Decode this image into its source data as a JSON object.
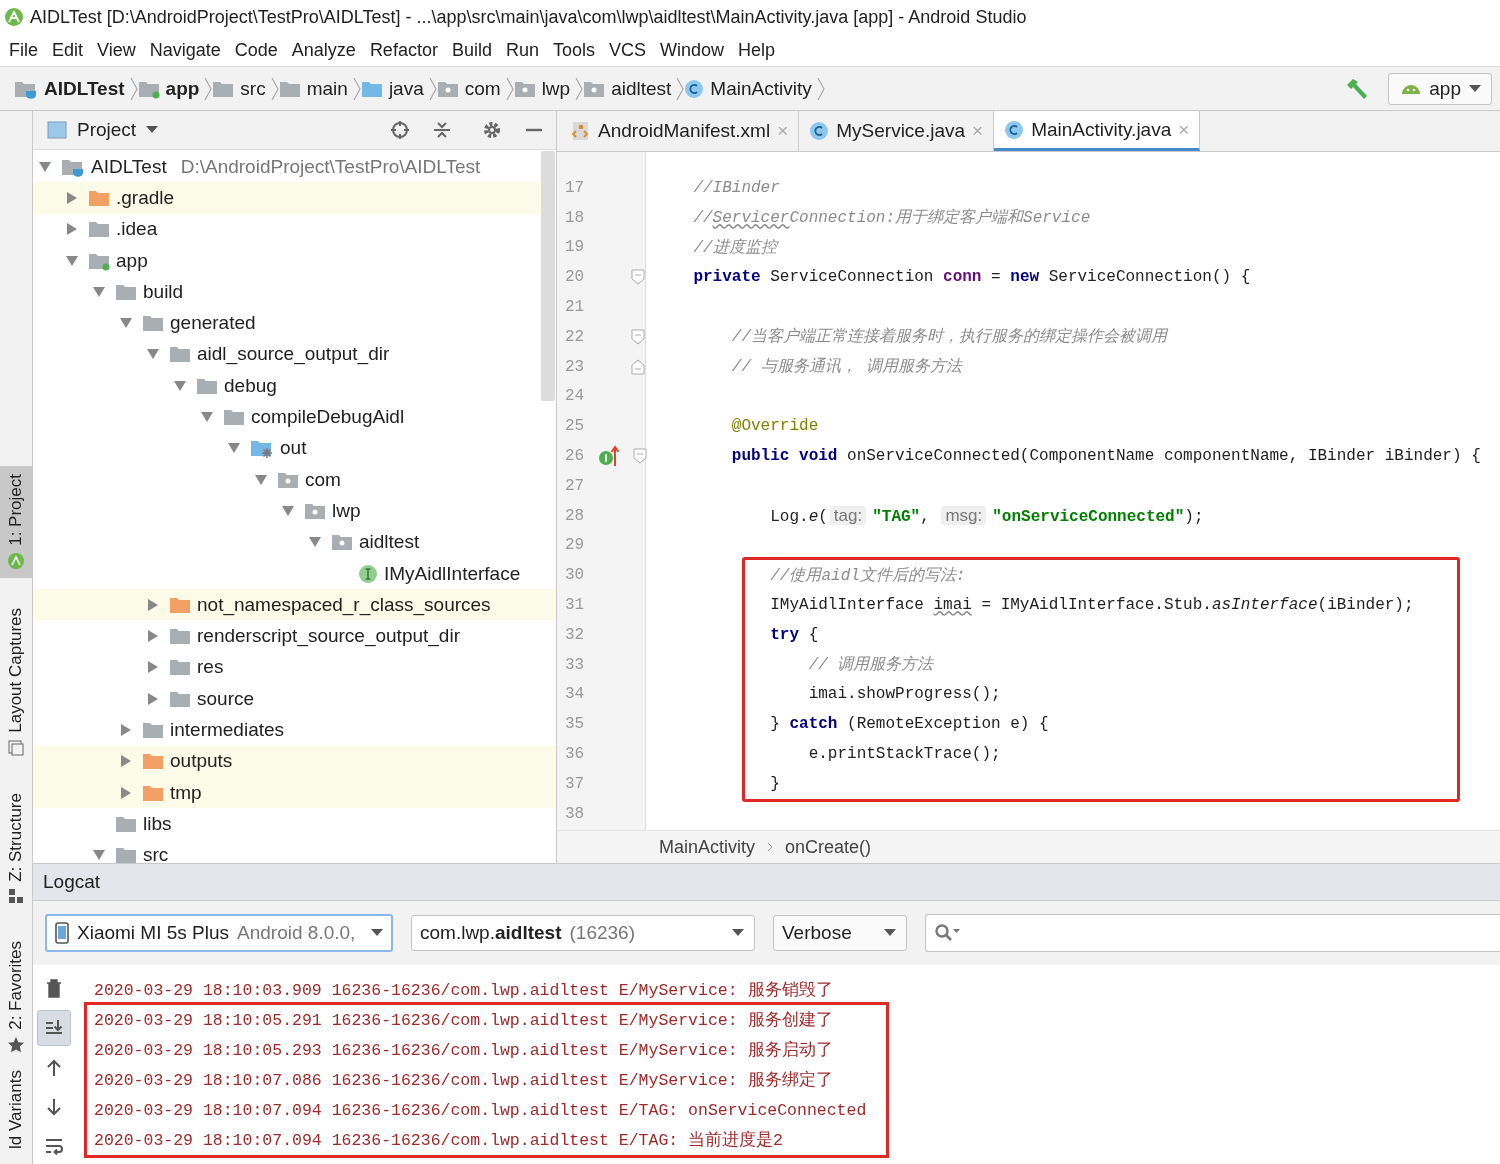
{
  "window": {
    "title": "AIDLTest [D:\\AndroidProject\\TestPro\\AIDLTest] - ...\\app\\src\\main\\java\\com\\lwp\\aidltest\\MainActivity.java [app] - Android Studio"
  },
  "menu": [
    "File",
    "Edit",
    "View",
    "Navigate",
    "Code",
    "Analyze",
    "Refactor",
    "Build",
    "Run",
    "Tools",
    "VCS",
    "Window",
    "Help"
  ],
  "navigation_bar": {
    "crumbs": [
      {
        "label": "AIDLTest",
        "kind": "project"
      },
      {
        "label": "app",
        "kind": "module"
      },
      {
        "label": "src",
        "kind": "folder"
      },
      {
        "label": "main",
        "kind": "folder"
      },
      {
        "label": "java",
        "kind": "source"
      },
      {
        "label": "com",
        "kind": "package"
      },
      {
        "label": "lwp",
        "kind": "package"
      },
      {
        "label": "aidltest",
        "kind": "package"
      },
      {
        "label": "MainActivity",
        "kind": "class"
      }
    ],
    "run_config": "app"
  },
  "tool_strip": [
    {
      "label": "1: Project",
      "kind": "android",
      "selected": true
    },
    {
      "label": "Layout Captures",
      "kind": "capture",
      "selected": false
    },
    {
      "label": "Z: Structure",
      "kind": "structure",
      "selected": false
    },
    {
      "label": "2: Favorites",
      "kind": "star",
      "selected": false
    },
    {
      "label": "ld Variants",
      "kind": "none",
      "selected": false
    }
  ],
  "project_panel": {
    "title": "Project",
    "tree": [
      {
        "label": "AIDLTest",
        "path": "D:\\AndroidProject\\TestPro\\AIDLTest",
        "kind": "project",
        "expanded": true,
        "children": [
          {
            "label": ".gradle",
            "kind": "excluded",
            "expanded": false
          },
          {
            "label": ".idea",
            "kind": "folder",
            "expanded": false
          },
          {
            "label": "app",
            "kind": "module",
            "expanded": true,
            "children": [
              {
                "label": "build",
                "kind": "folder",
                "expanded": true,
                "children": [
                  {
                    "label": "generated",
                    "kind": "folder",
                    "expanded": true,
                    "children": [
                      {
                        "label": "aidl_source_output_dir",
                        "kind": "folder",
                        "expanded": true,
                        "children": [
                          {
                            "label": "debug",
                            "kind": "folder",
                            "expanded": true,
                            "children": [
                              {
                                "label": "compileDebugAidl",
                                "kind": "folder",
                                "expanded": true,
                                "children": [
                                  {
                                    "label": "out",
                                    "kind": "generated",
                                    "expanded": true,
                                    "children": [
                                      {
                                        "label": "com",
                                        "kind": "package",
                                        "expanded": true,
                                        "children": [
                                          {
                                            "label": "lwp",
                                            "kind": "package",
                                            "expanded": true,
                                            "children": [
                                              {
                                                "label": "aidltest",
                                                "kind": "package",
                                                "expanded": true,
                                                "children": [
                                                  {
                                                    "label": "IMyAidlInterface",
                                                    "kind": "interface"
                                                  }
                                                ]
                                              }
                                            ]
                                          }
                                        ]
                                      }
                                    ]
                                  }
                                ]
                              }
                            ]
                          }
                        ]
                      },
                      {
                        "label": "not_namespaced_r_class_sources",
                        "kind": "excluded",
                        "expanded": false
                      },
                      {
                        "label": "renderscript_source_output_dir",
                        "kind": "folder",
                        "expanded": false
                      },
                      {
                        "label": "res",
                        "kind": "folder",
                        "expanded": false
                      },
                      {
                        "label": "source",
                        "kind": "folder",
                        "expanded": false
                      }
                    ]
                  },
                  {
                    "label": "intermediates",
                    "kind": "folder",
                    "expanded": false
                  },
                  {
                    "label": "outputs",
                    "kind": "excluded",
                    "expanded": false
                  },
                  {
                    "label": "tmp",
                    "kind": "excluded",
                    "expanded": false
                  }
                ]
              },
              {
                "label": "libs",
                "kind": "folder"
              },
              {
                "label": "src",
                "kind": "folder",
                "expanded": true
              }
            ]
          }
        ]
      }
    ]
  },
  "editor": {
    "tabs": [
      {
        "label": "AndroidManifest.xml",
        "kind": "xml",
        "selected": false,
        "close": "×"
      },
      {
        "label": "MyService.java",
        "kind": "class",
        "selected": false,
        "close": "×"
      },
      {
        "label": "MainActivity.java",
        "kind": "class",
        "selected": true,
        "close": "×"
      }
    ],
    "lines": [
      {
        "number": "17",
        "marked": false,
        "tokens": [
          {
            "kind": "comment",
            "text": "    //IBinder"
          }
        ]
      },
      {
        "number": "18",
        "marked": false,
        "tokens": [
          {
            "kind": "comment",
            "text": "    //"
          },
          {
            "kind": "comment-warn",
            "text": "Servicer"
          },
          {
            "kind": "comment",
            "text": "Connection:用于绑定客户端和Service"
          }
        ]
      },
      {
        "number": "19",
        "marked": false,
        "tokens": [
          {
            "kind": "comment",
            "text": "    //进度监控"
          }
        ]
      },
      {
        "number": "20",
        "marked": false,
        "gutter_icons": [
          {
            "kind": "fold-start"
          }
        ],
        "tokens": [
          {
            "kind": "keyword",
            "text": "    private"
          },
          {
            "kind": "plain",
            "text": " ServiceConnection "
          },
          {
            "kind": "field",
            "text": "conn"
          },
          {
            "kind": "plain",
            "text": " = "
          },
          {
            "kind": "keyword",
            "text": "new"
          },
          {
            "kind": "plain",
            "text": " ServiceConnection() {"
          }
        ]
      },
      {
        "number": "21",
        "marked": false
      },
      {
        "number": "22",
        "marked": false,
        "gutter_icons": [
          {
            "kind": "fold-start"
          }
        ],
        "tokens": [
          {
            "kind": "comment",
            "text": "        //当客户端正常连接着服务时，执行服务的绑定操作会被调用"
          }
        ]
      },
      {
        "number": "23",
        "marked": false,
        "gutter_icons": [
          {
            "kind": "fold-end"
          }
        ],
        "tokens": [
          {
            "kind": "comment",
            "text": "        // 与服务通讯， 调用服务方法"
          }
        ]
      },
      {
        "number": "24",
        "marked": false
      },
      {
        "number": "25",
        "marked": false,
        "tokens": [
          {
            "kind": "annotation",
            "text": "        @Override"
          }
        ]
      },
      {
        "number": "26",
        "marked": false,
        "gutter_icons": [
          {
            "kind": "implements"
          },
          {
            "kind": "fold-start"
          }
        ],
        "tokens": [
          {
            "kind": "keyword",
            "text": "        public void"
          },
          {
            "kind": "plain",
            "text": " onServiceConnected(ComponentName componentName, IBinder iBinder) {"
          }
        ]
      },
      {
        "number": "27",
        "marked": false
      },
      {
        "number": "28",
        "marked": false,
        "tokens": [
          {
            "kind": "plain",
            "text": "            Log."
          },
          {
            "kind": "italic",
            "text": "e"
          },
          {
            "kind": "plain",
            "text": "("
          },
          {
            "kind": "hint",
            "text": "tag:"
          },
          {
            "kind": "string",
            "text": "\"TAG\""
          },
          {
            "kind": "plain",
            "text": ", "
          },
          {
            "kind": "hint",
            "text": "msg:"
          },
          {
            "kind": "string",
            "text": "\"onServiceConnected\""
          },
          {
            "kind": "plain",
            "text": ");"
          }
        ]
      },
      {
        "number": "29",
        "marked": false
      },
      {
        "number": "30",
        "marked": true,
        "tokens": [
          {
            "kind": "comment",
            "text": "            //使用aidl文件后的写法:"
          }
        ]
      },
      {
        "number": "31",
        "marked": true,
        "tokens": [
          {
            "kind": "plain",
            "text": "            IMyAidlInterface "
          },
          {
            "kind": "warn",
            "text": "imai"
          },
          {
            "kind": "plain",
            "text": " = IMyAidlInterface.Stub."
          },
          {
            "kind": "italic",
            "text": "asInterface"
          },
          {
            "kind": "plain",
            "text": "(iBinder);"
          }
        ]
      },
      {
        "number": "32",
        "marked": true,
        "tokens": [
          {
            "kind": "keyword",
            "text": "            try"
          },
          {
            "kind": "plain",
            "text": " {"
          }
        ]
      },
      {
        "number": "33",
        "marked": true,
        "tokens": [
          {
            "kind": "comment",
            "text": "                // 调用服务方法"
          }
        ]
      },
      {
        "number": "34",
        "marked": true,
        "tokens": [
          {
            "kind": "plain",
            "text": "                imai.showProgress();"
          }
        ]
      },
      {
        "number": "35",
        "marked": true,
        "tokens": [
          {
            "kind": "plain",
            "text": "            } "
          },
          {
            "kind": "keyword",
            "text": "catch"
          },
          {
            "kind": "plain",
            "text": " (RemoteException e) {"
          }
        ]
      },
      {
        "number": "36",
        "marked": true,
        "tokens": [
          {
            "kind": "plain",
            "text": "                e.printStackTrace();"
          }
        ]
      },
      {
        "number": "37",
        "marked": true,
        "tokens": [
          {
            "kind": "plain",
            "text": "            }"
          }
        ]
      },
      {
        "number": "38",
        "marked": false
      }
    ],
    "breadcrumbs": [
      "MainActivity",
      "onCreate()"
    ]
  },
  "logcat": {
    "title": "Logcat",
    "device": {
      "name": "Xiaomi MI 5s Plus",
      "detail": "Android 8.0.0,"
    },
    "process": {
      "name": "com.lwp.**aidltest**",
      "pid": "(16236)"
    },
    "level": "Verbose",
    "tools": [
      {
        "kind": "trash",
        "selected": false
      },
      {
        "kind": "scroll-end",
        "selected": true
      },
      {
        "kind": "up",
        "selected": false
      },
      {
        "kind": "down",
        "selected": false
      },
      {
        "kind": "wrap",
        "selected": false
      }
    ],
    "lines": [
      {
        "text": "2020-03-29 18:10:03.909 16236-16236/com.lwp.aidltest E/MyService: 服务销毁了",
        "marked": false
      },
      {
        "text": "2020-03-29 18:10:05.291 16236-16236/com.lwp.aidltest E/MyService: 服务创建了",
        "marked": true
      },
      {
        "text": "2020-03-29 18:10:05.293 16236-16236/com.lwp.aidltest E/MyService: 服务启动了",
        "marked": true
      },
      {
        "text": "2020-03-29 18:10:07.086 16236-16236/com.lwp.aidltest E/MyService: 服务绑定了",
        "marked": true
      },
      {
        "text": "2020-03-29 18:10:07.094 16236-16236/com.lwp.aidltest E/TAG: onServiceConnected",
        "marked": true
      },
      {
        "text": "2020-03-29 18:10:07.094 16236-16236/com.lwp.aidltest E/TAG: 当前进度是2",
        "marked": true
      }
    ]
  }
}
